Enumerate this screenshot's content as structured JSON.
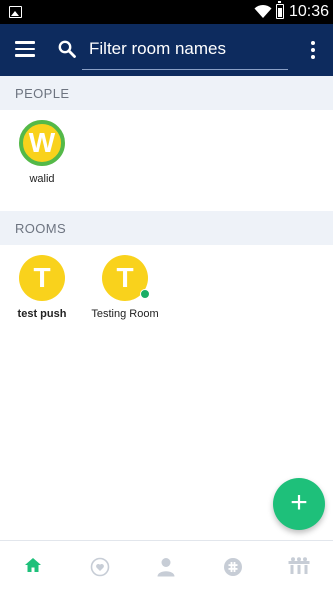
{
  "status_bar": {
    "time": "10:36",
    "icons": [
      "image-icon",
      "wifi-icon",
      "battery-icon"
    ]
  },
  "toolbar": {
    "filter_label": "Filter room names",
    "icons": [
      "menu-icon",
      "search-icon",
      "more-vert-icon"
    ],
    "background": "#0d2b5e"
  },
  "people": {
    "header": "PEOPLE",
    "items": [
      {
        "initial": "W",
        "name": "walid",
        "ring_color": "#54b948",
        "avatar_color": "#f9d21c"
      }
    ]
  },
  "rooms": {
    "header": "ROOMS",
    "items": [
      {
        "initial": "T",
        "name": "test push",
        "bold": true,
        "avatar_color": "#f9d21c"
      },
      {
        "initial": "T",
        "name": "Testing Room",
        "bold": false,
        "encrypted": true,
        "avatar_color": "#f9d21c"
      }
    ]
  },
  "fab": {
    "icon": "plus-icon",
    "symbol": "+",
    "color": "#1ec07a"
  },
  "bottom_nav": {
    "tabs": [
      {
        "icon": "home-icon",
        "active": true
      },
      {
        "icon": "favourites-icon",
        "active": false
      },
      {
        "icon": "people-icon",
        "active": false
      },
      {
        "icon": "chat-icon",
        "active": false
      },
      {
        "icon": "rooms-directory-icon",
        "active": false
      }
    ],
    "active_color": "#1ec07a",
    "inactive_color": "#c7cdd6"
  }
}
